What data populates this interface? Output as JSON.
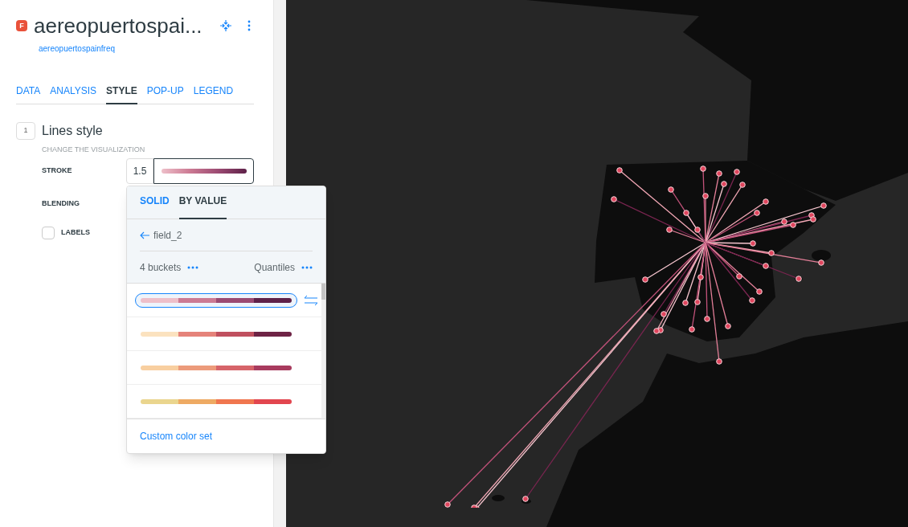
{
  "layer": {
    "badge": "F",
    "title": "aereopuertospai...",
    "subtitle": "aereopuertospainfreq"
  },
  "tabs": [
    {
      "label": "DATA",
      "selected": false
    },
    {
      "label": "ANALYSIS",
      "selected": false
    },
    {
      "label": "STYLE",
      "selected": true
    },
    {
      "label": "POP-UP",
      "selected": false
    },
    {
      "label": "LEGEND",
      "selected": false
    }
  ],
  "section": {
    "number": "1",
    "title": "Lines style",
    "subtitle": "CHANGE THE VISUALIZATION"
  },
  "stroke": {
    "label": "STROKE",
    "value": "1.5"
  },
  "blending": {
    "label": "BLENDING"
  },
  "labels": {
    "label": "LABELS",
    "checked": false
  },
  "popover": {
    "tabs": [
      {
        "label": "SOLID",
        "selected": false
      },
      {
        "label": "BY VALUE",
        "selected": true
      }
    ],
    "field": "field_2",
    "buckets": "4 buckets",
    "method": "Quantiles",
    "ramps": [
      {
        "swatches": [
          {
            "color": "#eebfc9"
          },
          {
            "color": "#cc7a93"
          },
          {
            "color": "#9b4a72"
          },
          {
            "color": "#5e2149"
          }
        ],
        "selected": true
      },
      {
        "swatches": [
          {
            "color": "#fbe2bf"
          },
          {
            "color": "#e5837a"
          },
          {
            "color": "#c0505f"
          },
          {
            "color": "#6e2345"
          }
        ],
        "selected": false
      },
      {
        "swatches": [
          {
            "color": "#f8cfa0"
          },
          {
            "color": "#ec9b7b"
          },
          {
            "color": "#d6646a"
          },
          {
            "color": "#a83b5e"
          }
        ],
        "selected": false
      },
      {
        "swatches": [
          {
            "color": "#ead58e"
          },
          {
            "color": "#eeaa63"
          },
          {
            "color": "#f0764f"
          },
          {
            "color": "#e2464f"
          }
        ],
        "selected": false
      }
    ],
    "custom_link": "Custom color set"
  }
}
